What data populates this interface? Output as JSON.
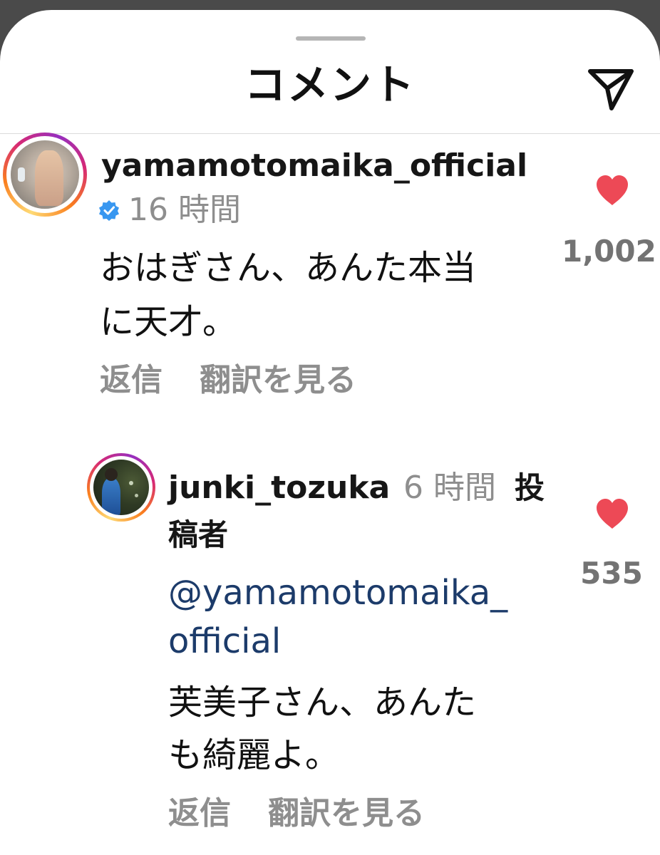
{
  "header": {
    "title": "コメント",
    "send_icon": "paper-plane-icon"
  },
  "comments": [
    {
      "username": "yamamotomaika_official",
      "verified": true,
      "time": "16 時間",
      "text_lines": [
        "おはぎさん、あんた本当",
        "に天才。"
      ],
      "reply_label": "返信",
      "translate_label": "翻訳を見る",
      "likes": "1,002"
    }
  ],
  "replies": [
    {
      "username": "junki_tozuka",
      "time": "6 時間",
      "author_tag_line1": "投",
      "author_tag_line2": "稿者",
      "mention_line1": "@yamamotomaika_",
      "mention_line2": "official",
      "text_lines": [
        "芙美子さん、あんた",
        "も綺麗よ。"
      ],
      "reply_label": "返信",
      "translate_label": "翻訳を見る",
      "likes": "535"
    }
  ],
  "colors": {
    "heart": "#ed4956",
    "verified": "#3897f0",
    "mention": "#1c3b6a",
    "secondary_text": "#8e8e8e"
  }
}
